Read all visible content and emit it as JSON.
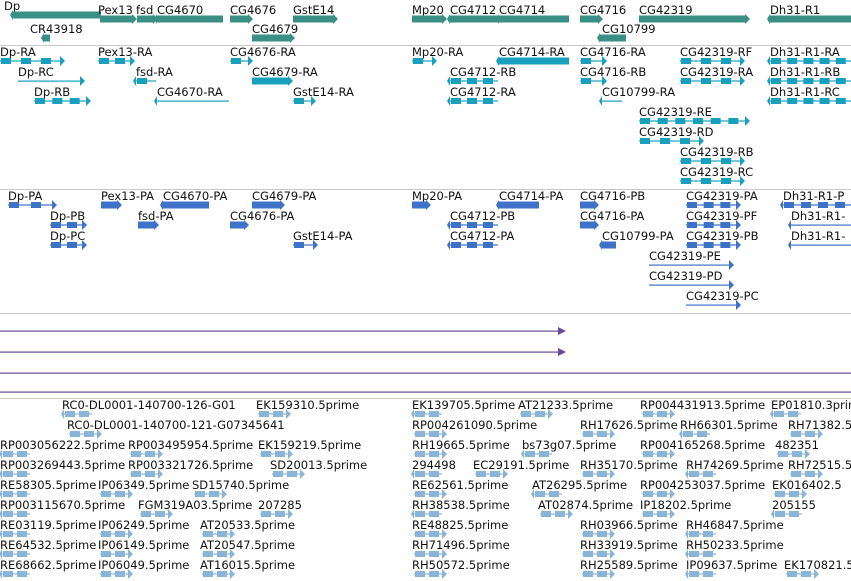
{
  "colors": {
    "gene": "#3a8f86",
    "transcript": "#1aa0bf",
    "protein": "#3d72c8",
    "line": "#6a4a9a",
    "est": "#8ab5d9",
    "separator": "#c8c8c8"
  },
  "genes_track": {
    "labels": [
      "Dp",
      "CR43918",
      "Pex13",
      "fsd",
      "CG4670",
      "CG4676",
      "CG4679",
      "GstE14",
      "Mp20",
      "CG4712",
      "CG4714",
      "CG4716",
      "CG10799",
      "CG42319",
      "Dh31-R1"
    ]
  },
  "transcripts_track": {
    "labels": [
      "Dp-RA",
      "Dp-RC",
      "Dp-RB",
      "Pex13-RA",
      "fsd-RA",
      "CG4670-RA",
      "CG4676-RA",
      "CG4679-RA",
      "GstE14-RA",
      "Mp20-RA",
      "CG4714-RA",
      "CG4712-RB",
      "CG4712-RA",
      "CG4716-RA",
      "CG4716-RB",
      "CG10799-RA",
      "CG42319-RF",
      "CG42319-RA",
      "CG42319-RE",
      "CG42319-RD",
      "CG42319-RB",
      "CG42319-RC",
      "Dh31-R1-RA",
      "Dh31-R1-RB",
      "Dh31-R1-RC"
    ]
  },
  "proteins_track": {
    "labels": [
      "Dp-PA",
      "Dp-PB",
      "Dp-PC",
      "Pex13-PA",
      "fsd-PA",
      "CG4670-PA",
      "CG4679-PA",
      "CG4676-PA",
      "GstE14-PA",
      "Mp20-PA",
      "CG4714-PA",
      "CG4712-PB",
      "CG4712-PA",
      "CG4716-PB",
      "CG4716-PA",
      "CG10799-PA",
      "CG42319-PA",
      "CG42319-PF",
      "CG42319-PB",
      "CG42319-PE",
      "CG42319-PD",
      "CG42319-PC",
      "Dh31-R1-P",
      "Dh31-R1-",
      "Dh31-R1-"
    ]
  },
  "est_track": {
    "labels": [
      "RC0-DL0001-140700-126-G01",
      "EK159310.5prime",
      "RC0-DL0001-140700-121-G07345641",
      "RP003056222.5prime",
      "RP003495954.5prime",
      "EK159219.5prime",
      "RP003269443.5prime",
      "RP003321726.5prime",
      "SD20013.5prime",
      "RE58305.5prime",
      "IP06349.5prime",
      "SD15740.5prime",
      "RP003115670.5prime",
      "FGM319A03.5prime",
      "207285",
      "RE03119.5prime",
      "IP06249.5prime",
      "AT20533.5prime",
      "RE64532.5prime",
      "IP06149.5prime",
      "AT20547.5prime",
      "RE68662.5prime",
      "IP06049.5prime",
      "AT16015.5prime",
      "EK139705.5prime",
      "AT21233.5prime",
      "RP004431913.5prime",
      "EP01810.3prime",
      "RP004261090.5prime",
      "RH17626.5prime",
      "RH66301.5prime",
      "RH71382.5",
      "RH19665.5prime",
      "bs73g07.5prime",
      "RP004165268.5prime",
      "482351",
      "294498",
      "EC29191.5prime",
      "RH35170.5prime",
      "RH74269.5prime",
      "RH72515.5",
      "RE62561.5prime",
      "AT26295.5prime",
      "RP004253037.5prime",
      "EK016402.5",
      "RH38538.5prime",
      "AT02874.5prime",
      "IP18202.5prime",
      "205155",
      "RE48825.5prime",
      "RH03966.5prime",
      "RH46847.5prime",
      "RH71496.5prime",
      "RH33919.5prime",
      "RH50233.5prime",
      "RH50572.5prime",
      "RH25589.5prime",
      "IP09637.5prime",
      "EK170821.5"
    ]
  }
}
